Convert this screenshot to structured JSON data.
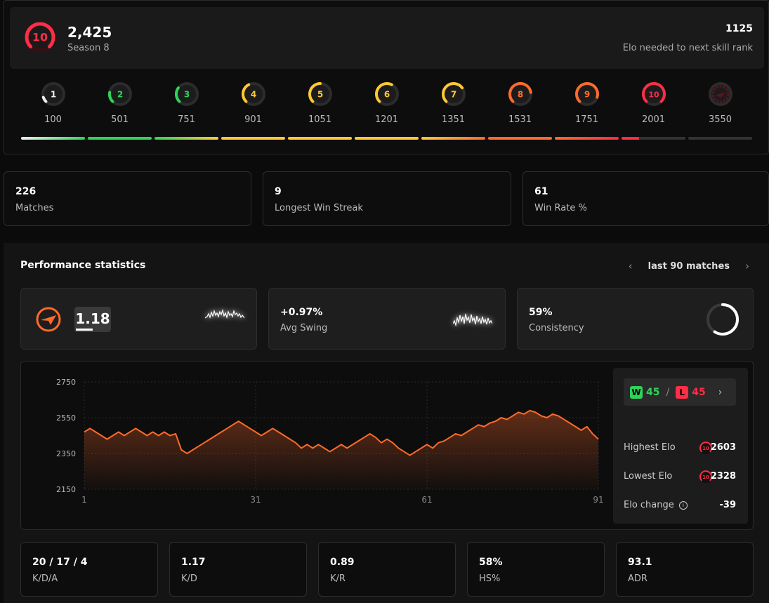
{
  "header": {
    "level": "10",
    "elo": "2,425",
    "season": "Season 8",
    "elo_needed": "1125",
    "elo_needed_label": "Elo needed to next skill rank",
    "accent": "#ff2d46"
  },
  "levels": [
    {
      "num": "1",
      "threshold": "100",
      "color": "#eeeeee",
      "fill": 1
    },
    {
      "num": "2",
      "threshold": "501",
      "color": "#2fd35a",
      "fill": 1
    },
    {
      "num": "3",
      "threshold": "751",
      "color": "#2fd35a",
      "fill": 1
    },
    {
      "num": "4",
      "threshold": "901",
      "color": "#ffc933",
      "fill": 1
    },
    {
      "num": "5",
      "threshold": "1051",
      "color": "#ffc933",
      "fill": 1
    },
    {
      "num": "6",
      "threshold": "1201",
      "color": "#ffc933",
      "fill": 1
    },
    {
      "num": "7",
      "threshold": "1351",
      "color": "#ffc933",
      "fill": 1
    },
    {
      "num": "8",
      "threshold": "1531",
      "color": "#ff6a2b",
      "fill": 1
    },
    {
      "num": "9",
      "threshold": "1751",
      "color": "#ff6a2b",
      "fill": 1
    },
    {
      "num": "10",
      "threshold": "2001",
      "color": "#ff2d46",
      "fill": 0.27
    },
    {
      "num": "",
      "threshold": "3550",
      "color": "#5a1520",
      "fill": 0
    }
  ],
  "summary": [
    {
      "value": "226",
      "label": "Matches"
    },
    {
      "value": "9",
      "label": "Longest Win Streak"
    },
    {
      "value": "61",
      "label": "Win Rate %"
    }
  ],
  "performance": {
    "title": "Performance statistics",
    "range_label": "last 90 matches",
    "rating": "1.18",
    "avg_swing_value": "+0.97%",
    "avg_swing_label": "Avg Swing",
    "consistency_value": "59%",
    "consistency_label": "Consistency",
    "consistency_fraction": 0.59
  },
  "record": {
    "w_tag": "W",
    "wins": "45",
    "separator": "/",
    "l_tag": "L",
    "losses": "45"
  },
  "elo_stats": [
    {
      "label": "Highest Elo",
      "level": "10",
      "value": "2603"
    },
    {
      "label": "Lowest Elo",
      "level": "10",
      "value": "2328"
    },
    {
      "label": "Elo change",
      "level": "",
      "value": "-39"
    }
  ],
  "bottom": [
    {
      "value": "20 / 17 / 4",
      "label": "K/D/A"
    },
    {
      "value": "1.17",
      "label": "K/D"
    },
    {
      "value": "0.89",
      "label": "K/R"
    },
    {
      "value": "58%",
      "label": "HS%"
    },
    {
      "value": "93.1",
      "label": "ADR"
    }
  ],
  "chart_data": {
    "type": "area",
    "y_ticks": [
      "2750",
      "2550",
      "2350",
      "2150"
    ],
    "x_ticks": [
      "1",
      "31",
      "61",
      "91"
    ],
    "ylim": [
      2150,
      2750
    ],
    "xlim": [
      1,
      91
    ],
    "grid": true,
    "color": "#ff6a2b",
    "series": [
      {
        "x": [
          1,
          2,
          3,
          4,
          5,
          6,
          7,
          8,
          9,
          10,
          11,
          12,
          13,
          14,
          15,
          16,
          17,
          18,
          19,
          20,
          21,
          22,
          23,
          24,
          25,
          26,
          27,
          28,
          29,
          30,
          31,
          32,
          33,
          34,
          35,
          36,
          37,
          38,
          39,
          40,
          41,
          42,
          43,
          44,
          45,
          46,
          47,
          48,
          49,
          50,
          51,
          52,
          53,
          54,
          55,
          56,
          57,
          58,
          59,
          60,
          61,
          62,
          63,
          64,
          65,
          66,
          67,
          68,
          69,
          70,
          71,
          72,
          73,
          74,
          75,
          76,
          77,
          78,
          79,
          80,
          81,
          82,
          83,
          84,
          85,
          86,
          87,
          88,
          89,
          90,
          91
        ],
        "values": [
          2470,
          2490,
          2470,
          2450,
          2430,
          2450,
          2470,
          2450,
          2470,
          2490,
          2470,
          2450,
          2470,
          2450,
          2470,
          2450,
          2460,
          2370,
          2350,
          2370,
          2390,
          2410,
          2430,
          2450,
          2470,
          2490,
          2510,
          2530,
          2510,
          2490,
          2470,
          2450,
          2470,
          2490,
          2470,
          2450,
          2430,
          2410,
          2380,
          2400,
          2380,
          2400,
          2380,
          2360,
          2380,
          2400,
          2380,
          2400,
          2420,
          2440,
          2460,
          2440,
          2410,
          2430,
          2410,
          2380,
          2360,
          2340,
          2360,
          2380,
          2400,
          2380,
          2410,
          2420,
          2440,
          2460,
          2450,
          2470,
          2490,
          2510,
          2500,
          2520,
          2530,
          2550,
          2540,
          2560,
          2580,
          2570,
          2590,
          2580,
          2560,
          2550,
          2570,
          2560,
          2540,
          2520,
          2500,
          2480,
          2500,
          2460,
          2430
        ]
      }
    ]
  }
}
